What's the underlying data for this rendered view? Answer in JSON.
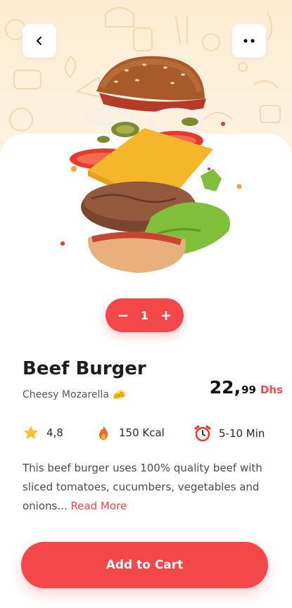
{
  "colors": {
    "accent": "#f3474a",
    "background_header": "#fdf0dc",
    "card": "#ffffff"
  },
  "header": {
    "back_icon": "chevron-left-icon",
    "more_icon": "more-dots-icon"
  },
  "quantity": {
    "minus": "−",
    "value": "1",
    "plus": "+"
  },
  "product": {
    "name": "Beef Burger",
    "subtitle": "Cheesy Mozarella",
    "subtitle_emoji": "🧀",
    "price_int": "22",
    "price_comma": ",",
    "price_dec": "99",
    "currency": "Dhs"
  },
  "stats": {
    "rating": {
      "icon": "star-icon",
      "value": "4,8"
    },
    "calories": {
      "icon": "fire-icon",
      "value": "150 Kcal"
    },
    "time": {
      "icon": "alarm-clock-icon",
      "value": "5-10 Min"
    }
  },
  "description": {
    "text": "This beef burger uses 100% quality beef with sliced tomatoes, cucumbers, vegetables and onions... ",
    "read_more": "Read More"
  },
  "cta": {
    "label": "Add to Cart"
  }
}
